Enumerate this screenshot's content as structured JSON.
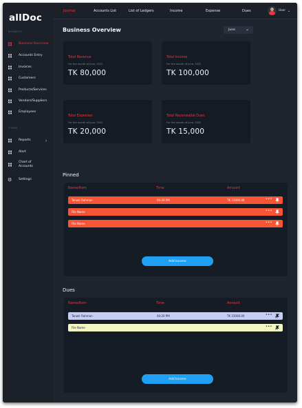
{
  "app": {
    "logo": "allDoc"
  },
  "sidebar": {
    "section_business": "BUSINESS",
    "section_other": "OTHER",
    "items": [
      {
        "label": "Business Overview",
        "active": true
      },
      {
        "label": "Accounts Entry",
        "active": false
      },
      {
        "label": "Invoices",
        "active": false
      },
      {
        "label": "Customers",
        "active": false
      },
      {
        "label": "Products/Services",
        "active": false
      },
      {
        "label": "Vendors/Suppliers",
        "active": false
      },
      {
        "label": "Employees",
        "active": false
      }
    ],
    "other_items": [
      {
        "label": "Reports",
        "has_chevron": true,
        "chevron": "›"
      },
      {
        "label": "Alert"
      },
      {
        "label": "Chart of Accounts"
      },
      {
        "label": "Settings",
        "icon": "gear-icon"
      }
    ]
  },
  "topbar": {
    "tabs": [
      {
        "label": "Journal",
        "active": true
      },
      {
        "label": "Accounts List",
        "active": false
      },
      {
        "label": "List of Ledgers",
        "active": false
      },
      {
        "label": "Income",
        "active": false
      },
      {
        "label": "Expense",
        "active": false
      },
      {
        "label": "Dues",
        "active": false
      }
    ],
    "user": {
      "name": "User",
      "chevron": "⌄",
      "avatar_icon": "user-avatar-icon"
    }
  },
  "overview": {
    "title": "Business Overview",
    "month": {
      "selected": "June",
      "chevron": "⌄"
    },
    "cards": [
      {
        "title": "Total Revenue",
        "subtitle": "For the month of June, 2022",
        "value": "TK 80,000"
      },
      {
        "title": "Total Income",
        "subtitle": "For the month of June, 2022",
        "value": "TK 100,000"
      },
      {
        "title": "Total Expenses",
        "subtitle": "For the month of June, 2022",
        "value": "TK 20,000"
      },
      {
        "title": "Total Receiveable Dues",
        "subtitle": "For the month of June, 2022",
        "value": "TK 15,000"
      }
    ]
  },
  "pinned": {
    "title": "Pinned",
    "columns": [
      "Name/Item",
      "Time",
      "Amount"
    ],
    "rows": [
      {
        "name": "Tanwir Rahman",
        "time": "04:20 PM",
        "amount": "TK 15000.00",
        "menu": "•••",
        "color": "orange"
      },
      {
        "name": "File Name",
        "time": "",
        "amount": "",
        "menu": "•••",
        "color": "orange"
      },
      {
        "name": "File Name",
        "time": "",
        "amount": "",
        "menu": "•••",
        "color": "orange"
      }
    ],
    "button": "Add Income"
  },
  "dues": {
    "title": "Dues",
    "columns": [
      "Name/Item",
      "Time",
      "Amount"
    ],
    "rows": [
      {
        "name": "Tanwir Rahman",
        "time": "04:20 PM",
        "amount": "TK 15000.00",
        "menu": "•••",
        "color": "blue"
      },
      {
        "name": "File Name",
        "time": "",
        "amount": "",
        "menu": "•••",
        "color": "yellow"
      }
    ],
    "button": "Add Income"
  },
  "colors": {
    "accent_red": "#f3343f",
    "row_orange": "#f75435",
    "row_blue": "#c5cdf4",
    "row_yellow": "#f5f7c2",
    "button_blue": "#1fa0f2",
    "background": "#1e252f",
    "card": "#151b24"
  }
}
